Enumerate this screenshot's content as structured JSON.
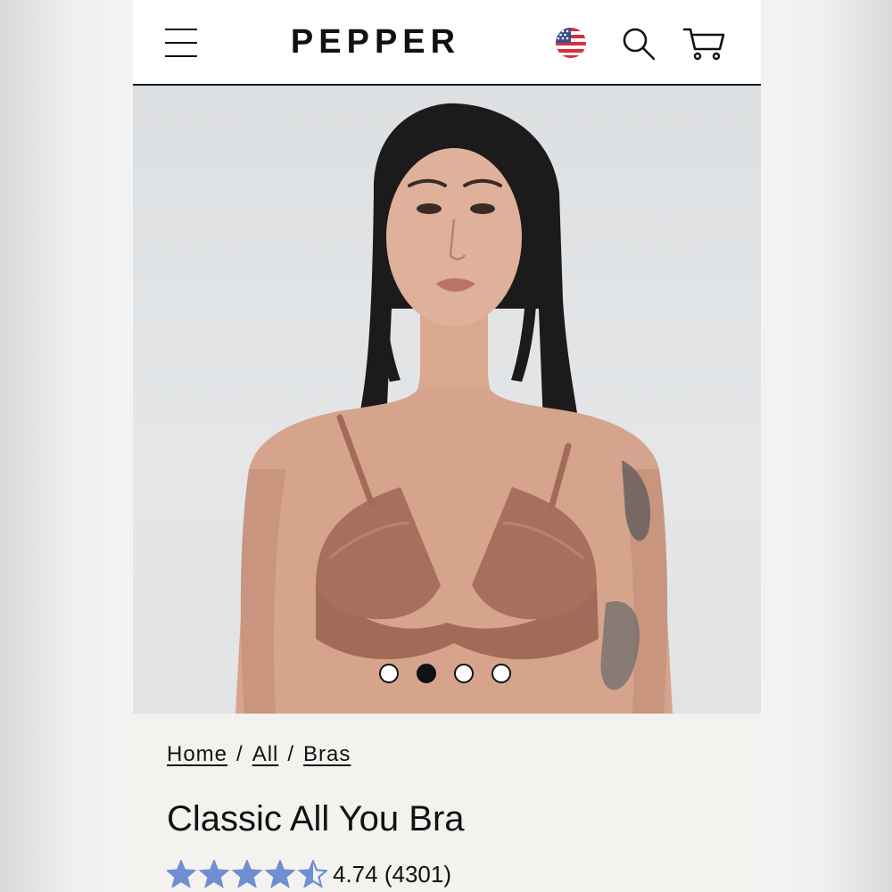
{
  "header": {
    "logo": "PEPPER",
    "icons": [
      "menu-icon",
      "us-flag-icon",
      "search-icon",
      "cart-icon"
    ]
  },
  "carousel": {
    "slide_count": 4,
    "active_index": 1
  },
  "breadcrumb": {
    "items": [
      "Home",
      "All",
      "Bras"
    ],
    "separator": "/"
  },
  "product": {
    "title": "Classic All You Bra",
    "rating_value": "4.74",
    "review_count": "(4301)",
    "rating_stars": 4.5
  },
  "colors": {
    "star": "#6f8fd3",
    "text": "#111111",
    "product_bg": "#f3f2ef"
  }
}
